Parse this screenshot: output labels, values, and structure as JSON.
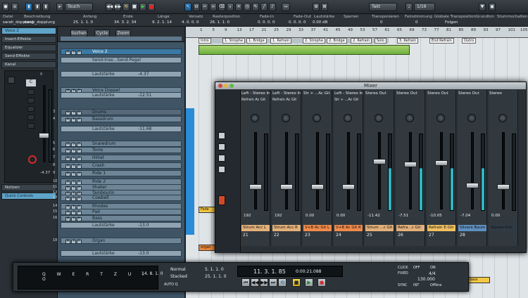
{
  "toolbar": {
    "mode": "Touch",
    "grid": "Takt",
    "quant": "1/16"
  },
  "infoline": {
    "headers": [
      "Datei",
      "Beschreibung",
      "Anfang",
      "Ende",
      "Länge",
      "Versatz",
      "Rasterposition",
      "Fade-In",
      "Fade-Out",
      "Lautstärke",
      "Sperren",
      "Transponieren",
      "Feinstimmung",
      "Globale Transposition",
      "Grundton",
      "Stummschalten"
    ],
    "values": [
      "sarah_dopplung",
      "sarah_dopplung",
      "25. 1. 1. 0",
      "34. 3. 2. 34",
      "9. 2. 1. 14",
      "4. 0. 0. 0",
      "26. 1. 1. 0",
      "0. 0. 0. 0",
      "0. 0. 0. 0",
      "0.00 dB",
      "",
      "0",
      "0",
      "Folgen",
      ""
    ]
  },
  "inspector": {
    "sections": [
      {
        "label": "Voice 2"
      },
      {
        "label": "Insert-Effekte"
      },
      {
        "label": "Equalizer"
      },
      {
        "label": "Send-Effekte"
      },
      {
        "label": "Kanal"
      }
    ],
    "fader_value": "-4.37",
    "fader_db": "6",
    "bottom_sections": [
      {
        "label": "Notizen"
      },
      {
        "label": "Quick Controls"
      }
    ]
  },
  "tracklist": {
    "header": [
      "Suchen",
      "Cycle",
      "Zoom"
    ],
    "tracks": [
      {
        "num": "",
        "name": "Voice 2",
        "type": "sel"
      },
      {
        "num": "",
        "name": "Send-Inse...Send-Pegel",
        "type": "sub"
      },
      {
        "num": "",
        "name": "Lautstärke",
        "type": "sub"
      },
      {
        "num": "",
        "name": "Voice Doppel",
        "type": "norm"
      },
      {
        "num": "",
        "name": "Lautstärke",
        "type": "sub"
      },
      {
        "num": "3",
        "name": "Drums",
        "type": "folder"
      },
      {
        "num": "4",
        "name": "Bassdrum",
        "type": "norm"
      },
      {
        "num": "",
        "name": "Lautstärke",
        "type": "sub"
      },
      {
        "num": "5",
        "name": "Snaredrum",
        "type": "norm"
      },
      {
        "num": "6",
        "name": "Toms",
        "type": "norm"
      },
      {
        "num": "7",
        "name": "HiHat",
        "type": "norm"
      },
      {
        "num": "8",
        "name": "Crash",
        "type": "norm"
      },
      {
        "num": "9",
        "name": "Ride 1",
        "type": "norm"
      },
      {
        "num": "10",
        "name": "Ride 2",
        "type": "norm"
      },
      {
        "num": "11",
        "name": "Shaker",
        "type": "norm"
      },
      {
        "num": "12",
        "name": "Tambourin",
        "type": "norm"
      },
      {
        "num": "13",
        "name": "Cowbell",
        "type": "norm"
      },
      {
        "num": "14",
        "name": "Rhodes",
        "type": "norm"
      },
      {
        "num": "15",
        "name": "Pad",
        "type": "norm"
      },
      {
        "num": "16",
        "name": "Bass",
        "type": "norm"
      },
      {
        "num": "",
        "name": "Lautstärke",
        "type": "sub"
      },
      {
        "num": "18",
        "name": "Organ",
        "type": "norm"
      },
      {
        "num": "",
        "name": "Lautstärke",
        "type": "sub"
      }
    ],
    "values": {
      "voice2_vol": "-4.37",
      "vd_vol": "-12.51",
      "bd_vol": "-11.68",
      "bass_vol": "-13.0",
      "organ_vol": "-13.0"
    }
  },
  "ruler": {
    "marks": [
      "1",
      "5",
      "9",
      "13",
      "17",
      "21",
      "25",
      "29",
      "33",
      "37",
      "41",
      "45",
      "49",
      "53",
      "57",
      "61",
      "65",
      "69",
      "73",
      "77",
      "81",
      "85",
      "89",
      "93",
      "97",
      "101",
      "105"
    ]
  },
  "arrange": {
    "markers": [
      "Intro",
      "1. Strophe",
      "1. Bridge",
      "1. Refrain",
      "2. Strophe",
      "2. Bridge",
      "2. Refrain",
      "Solo",
      "3. Refrain",
      "End Refrain",
      "Outro"
    ],
    "clips": [
      "organ",
      "organ",
      "organ",
      "organ",
      "organ",
      "organ",
      "organ",
      "organ",
      "organ",
      "Fade",
      "Fade",
      "Fade",
      "bass"
    ]
  },
  "mixer": {
    "title": "Mixer",
    "channels": [
      {
        "label": "Left - Stereo In",
        "insert": "Refrain Ac Git",
        "name": "Strum Acc L",
        "num": "21",
        "val": "192",
        "color": "#e3b07a"
      },
      {
        "label": "Left - Stereo In",
        "insert": "Refrain Ac Git",
        "name": "Strum Acc R",
        "num": "22",
        "val": "192",
        "color": "#e3b07a"
      },
      {
        "label": "Str + ...Ac Git",
        "insert": "",
        "name": "V+B Ac Git L",
        "num": "23",
        "val": "0.00",
        "color": "#f08a4a"
      },
      {
        "label": "Left - Stereo In",
        "insert": "Str + ...Ac Git",
        "name": "V+B Ac Git R",
        "num": "24",
        "val": "0.00",
        "color": "#f08a4a"
      },
      {
        "label": "Stereo Out",
        "insert": "",
        "name": "Strum ...c Git",
        "num": "25",
        "val": "-11.42",
        "color": "#e3b07a"
      },
      {
        "label": "Stereo Out",
        "insert": "",
        "name": "Refra...c Git",
        "num": "26",
        "val": "-7.51",
        "color": "#e3b07a"
      },
      {
        "label": "Stereo Out",
        "insert": "",
        "name": "Refrain E-Gtr",
        "num": "27",
        "val": "-10.05",
        "color": "#f0c060"
      },
      {
        "label": "Stereo Out",
        "insert": "",
        "name": "Silvere Baum",
        "num": "28",
        "val": "-7.04",
        "color": "#5f8fbf"
      },
      {
        "label": "Stereo",
        "insert": "",
        "name": "Stereo-Out",
        "num": "",
        "val": "0.00",
        "color": "#2f3a44"
      }
    ]
  },
  "transport": {
    "mode_a": "Normal",
    "mode_b": "Stacked",
    "auto_q": "AUTO Q",
    "left": "5. 1. 1. 0",
    "right": "25. 1. 1. 0",
    "pos_bars": "11. 3. 1. 85",
    "pos_time": "0:00:21.088",
    "click": "CLICK",
    "tempo_mode": "FIXED",
    "sig": "4/4",
    "tempo": "130.000",
    "sync": "SYNC",
    "int": "INT",
    "offline": "Offline",
    "off": "OFF",
    "on": "ON",
    "rec_val": "14. 8. 1. 0",
    "keys": "Q W E R T Z U I O"
  }
}
